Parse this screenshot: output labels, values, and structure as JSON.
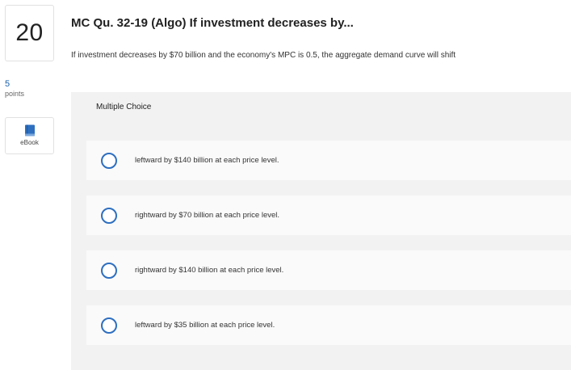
{
  "question": {
    "number": "20",
    "points_value": "5",
    "points_label": "points",
    "ebook_label": "eBook",
    "title": "MC Qu. 32-19 (Algo) If investment decreases by...",
    "prompt": "If investment decreases by $70 billion and the economy's MPC is 0.5, the aggregate demand curve will shift"
  },
  "multiple_choice": {
    "label": "Multiple Choice",
    "options": [
      {
        "text": "leftward by $140 billion at each price level."
      },
      {
        "text": "rightward by $70 billion at each price level."
      },
      {
        "text": "rightward by $140 billion at each price level."
      },
      {
        "text": "leftward by $35 billion at each price level."
      }
    ]
  },
  "colors": {
    "accent": "#2e6fc0",
    "points_value": "#1a5fa8",
    "panel_bg": "#f2f2f2",
    "option_bg": "#fafafa"
  },
  "icons": {
    "ebook": "book-icon",
    "option_selector": "radio-circle"
  }
}
